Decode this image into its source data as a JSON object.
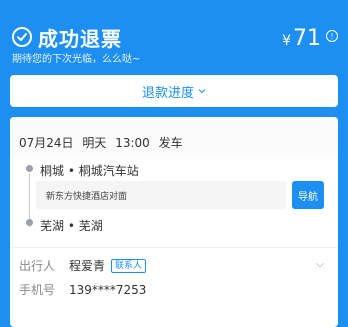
{
  "header": {
    "title": "成功退票",
    "subtitle": "期待您的下次光临，么么哒~",
    "currency": "¥",
    "amount": "71",
    "info_icon": "info-circle-icon",
    "accent": "#1c8ff0"
  },
  "progress": {
    "label": "退款进度"
  },
  "trip": {
    "date": "07月24日",
    "day": "明天",
    "time": "13:00",
    "depart_label": "发车",
    "from": "桐城 • 桐城汽车站",
    "address": "新东方快捷酒店对面",
    "nav_label": "导航",
    "to": "芜湖 • 芜湖"
  },
  "passenger": {
    "label": "出行人",
    "name": "程爱青",
    "tag": "联系人"
  },
  "phone": {
    "label": "手机号",
    "value": "139****7253"
  }
}
